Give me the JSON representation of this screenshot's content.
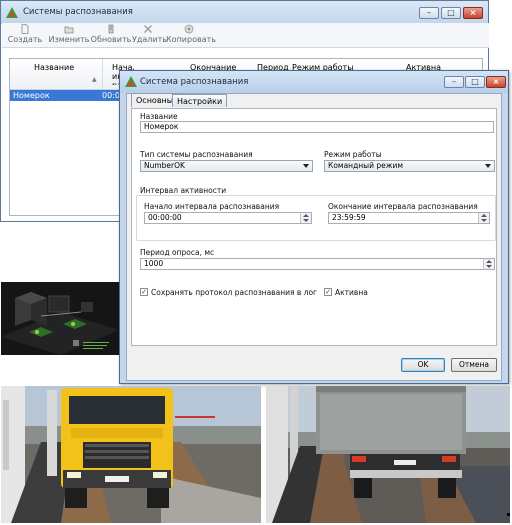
{
  "main_window": {
    "title": "Системы распознавания",
    "toolbar": [
      {
        "label": "Создать",
        "icon": "document-new-icon"
      },
      {
        "label": "Изменить",
        "icon": "folder-edit-icon"
      },
      {
        "label": "Обновить",
        "icon": "refresh-icon"
      },
      {
        "label": "Удалить",
        "icon": "delete-x-icon"
      },
      {
        "label": "Копировать",
        "icon": "copy-icon"
      }
    ],
    "columns": {
      "name": "Название",
      "start": "Начало интервала распознавания",
      "end": "Окончание",
      "period": "Период",
      "mode": "Режим работы",
      "active": "Активна"
    },
    "rows": [
      {
        "name": "Номерок",
        "start": "00:00:"
      }
    ]
  },
  "dialog": {
    "title": "Система распознавания",
    "tabs": [
      "Основные",
      "Настройки"
    ],
    "name_label": "Название",
    "name_value": "Номерок",
    "type_label": "Тип системы распознавания",
    "type_value": "NumberOK",
    "mode_label": "Режим работы",
    "mode_value": "Командный режим",
    "interval_group": "Интервал активности",
    "start_label": "Начало интервала распознавания",
    "start_value": "00:00:00",
    "end_label": "Окончание интервала распознавания",
    "end_value": "23:59:59",
    "period_label": "Период опроса, мс",
    "period_value": "1000",
    "save_log_label": "Сохранять протокол распознавания в лог",
    "save_log_checked": true,
    "active_label": "Активна",
    "active_checked": true,
    "ok_label": "OK",
    "cancel_label": "Отмена"
  },
  "colors": {
    "selection": "#3a78d6",
    "title_gradient": "#c3d6ec",
    "truck_cab": "#f2c21a"
  }
}
